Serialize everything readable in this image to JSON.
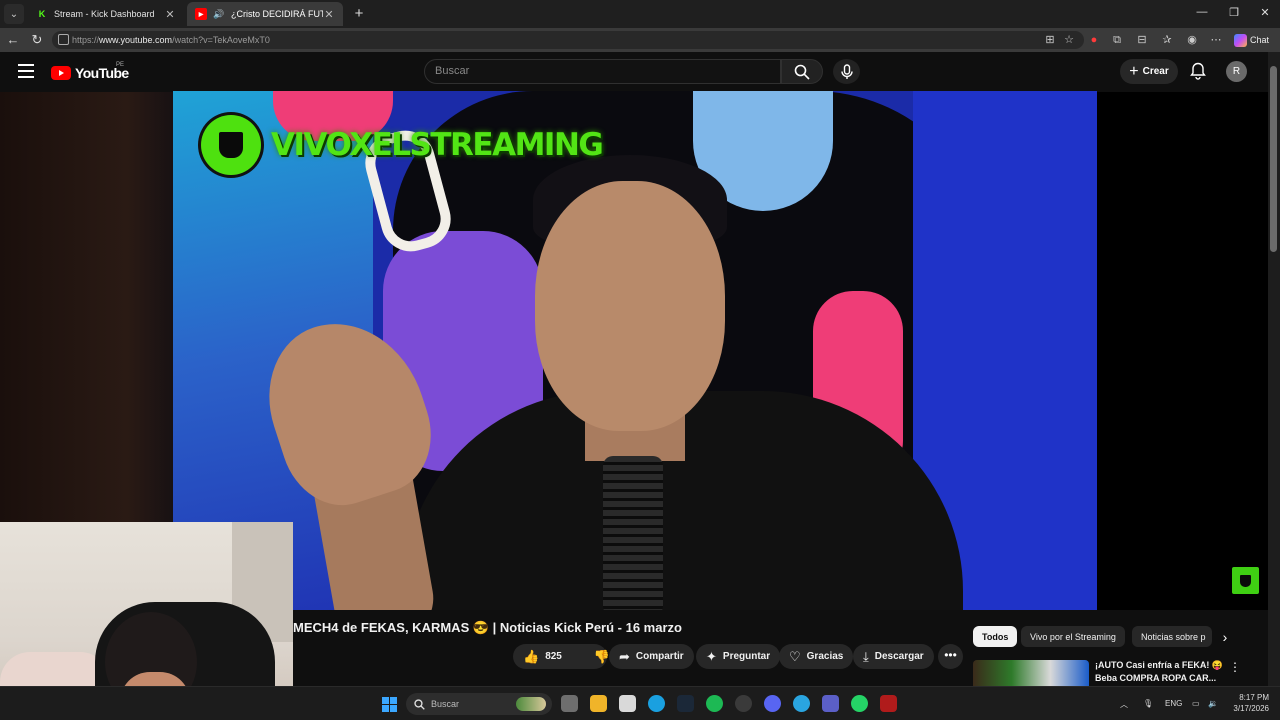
{
  "browser": {
    "tabs": [
      {
        "title": "Stream - Kick Dashboard",
        "favicon": "K"
      },
      {
        "title": "¿Cristo DECIDIRÁ FUTURO",
        "favicon": "▶"
      }
    ],
    "url_prefix": "https://",
    "url_host": "www.youtube.com",
    "url_path": "/watch?v=TekAoveMxT0",
    "chat_label": "Chat"
  },
  "youtube": {
    "logo": "YouTube",
    "region": "PE",
    "search_placeholder": "Buscar",
    "create_label": "Crear",
    "avatar_letter": "R"
  },
  "video": {
    "overlay_brand": "VIVOXELSTREAMING",
    "title": "MECH4 de FEKAS, KARMAS 😎 | Noticias Kick Perú - 16 marzo",
    "likes": "825",
    "actions": {
      "share": "Compartir",
      "ask": "Preguntar",
      "thanks": "Gracias",
      "download": "Descargar"
    }
  },
  "chips": [
    "Todos",
    "Vivo por el Streaming",
    "Noticias sobre p"
  ],
  "recommendation": {
    "title": "¡AUTO Casi enfría a FEKA! 😝 Beba COMPRA ROPA CAR..."
  },
  "taskbar": {
    "search_placeholder": "Buscar",
    "lang": "ENG",
    "time": "8:17 PM",
    "date": "3/17/2026"
  },
  "colors": {
    "brand_green": "#52e515",
    "youtube_red": "#ff0000",
    "kick_green": "#53fc18"
  }
}
